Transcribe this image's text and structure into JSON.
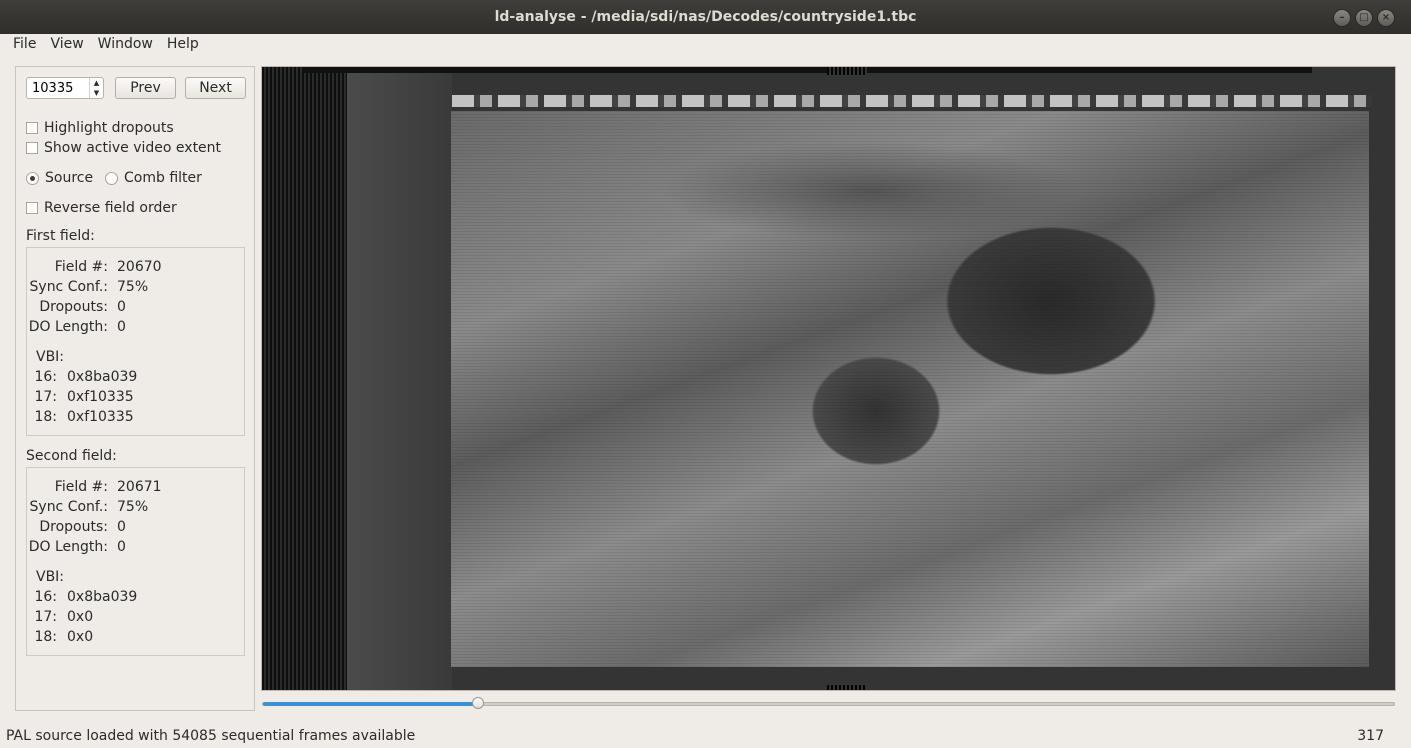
{
  "window": {
    "title": "ld-analyse - /media/sdi/nas/Decodes/countryside1.tbc"
  },
  "menu": [
    "File",
    "View",
    "Window",
    "Help"
  ],
  "controls": {
    "frame_number": "10335",
    "prev_label": "Prev",
    "next_label": "Next",
    "highlight_dropouts": "Highlight dropouts",
    "show_active_video": "Show active video extent",
    "source_label": "Source",
    "comb_filter_label": "Comb filter",
    "reverse_field_order": "Reverse field order"
  },
  "first_field": {
    "heading": "First field:",
    "field_num_label": "Field #:",
    "field_num": "20670",
    "sync_label": "Sync Conf.:",
    "sync": "75%",
    "dropouts_label": "Dropouts:",
    "dropouts": "0",
    "do_length_label": "DO Length:",
    "do_length": "0",
    "vbi_label": "VBI:",
    "vbi": [
      {
        "line": "16:",
        "value": "0x8ba039"
      },
      {
        "line": "17:",
        "value": "0xf10335"
      },
      {
        "line": "18:",
        "value": "0xf10335"
      }
    ]
  },
  "second_field": {
    "heading": "Second field:",
    "field_num_label": "Field #:",
    "field_num": "20671",
    "sync_label": "Sync Conf.:",
    "sync": "75%",
    "dropouts_label": "Dropouts:",
    "dropouts": "0",
    "do_length_label": "DO Length:",
    "do_length": "0",
    "vbi_label": "VBI:",
    "vbi": [
      {
        "line": "16:",
        "value": "0x8ba039"
      },
      {
        "line": "17:",
        "value": "0x0"
      },
      {
        "line": "18:",
        "value": "0x0"
      }
    ]
  },
  "slider": {
    "position": 0.19
  },
  "status": {
    "message": "PAL source loaded with 54085 sequential frames available",
    "right": "317"
  },
  "colors": {
    "accent": "#3d8fd6",
    "titlebar": "#3c3b37"
  }
}
